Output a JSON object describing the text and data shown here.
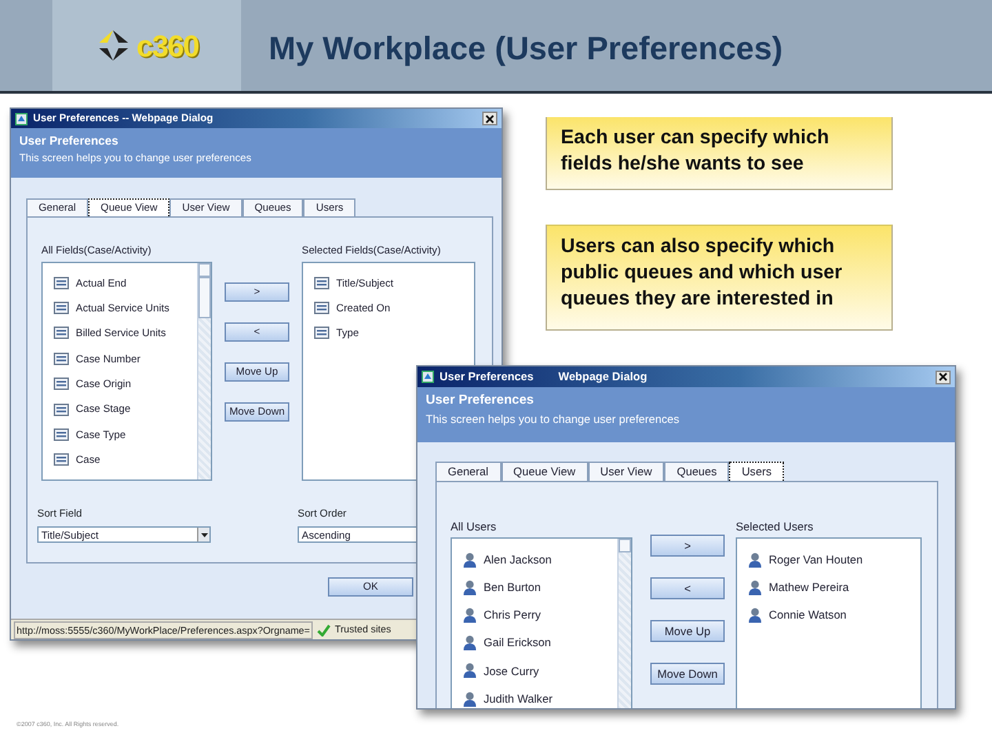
{
  "slide": {
    "title": "My Workplace (User Preferences)",
    "logo_text": "c360",
    "footer": "©2007 c360, Inc. All Rights reserved."
  },
  "callouts": [
    {
      "text": "Each user can specify which fields he/she wants to see"
    },
    {
      "text": "Users can also specify which public queues and which user queues they are interested in"
    }
  ],
  "dialogs": [
    {
      "title": [
        "User Preferences -- Webpage Dialog"
      ],
      "heading": "User Preferences",
      "subheading": "This screen helps you to change user preferences",
      "tabs": [
        {
          "label": "General",
          "selected": false
        },
        {
          "label": "Queue View",
          "selected": true
        },
        {
          "label": "User View",
          "selected": false
        },
        {
          "label": "Queues",
          "selected": false
        },
        {
          "label": "Users",
          "selected": false
        }
      ],
      "kind": "field",
      "left_label": "All Fields(Case/Activity)",
      "left_items": [
        "Actual End",
        "Actual Service Units",
        "Billed Service Units",
        "Case Number",
        "Case Origin",
        "Case Stage",
        "Case Type",
        "Case"
      ],
      "right_label": "Selected Fields(Case/Activity)",
      "right_items": [
        "Title/Subject",
        "Created On",
        "Type"
      ],
      "buttons": [
        ">",
        "<",
        "Move Up",
        "Move Down"
      ],
      "sort_field_label": "Sort Field",
      "sort_field_value": "Title/Subject",
      "sort_order_label": "Sort Order",
      "sort_order_value": "Ascending",
      "ok_button": "OK",
      "status_url": "http://moss:5555/c360/MyWorkPlace/Preferences.aspx?Orgname=",
      "status_zone": "Trusted sites"
    },
    {
      "title": [
        "User Preferences",
        "Webpage Dialog"
      ],
      "heading": "User Preferences",
      "subheading": "This screen helps you to change user preferences",
      "tabs": [
        {
          "label": "General",
          "selected": false
        },
        {
          "label": "Queue View",
          "selected": false
        },
        {
          "label": "User View",
          "selected": false
        },
        {
          "label": "Queues",
          "selected": false
        },
        {
          "label": "Users",
          "selected": true
        }
      ],
      "kind": "user",
      "left_label": "All Users",
      "left_items": [
        "Alen Jackson",
        "Ben Burton",
        "Chris Perry",
        "Gail Erickson",
        "Jose Curry",
        "Judith Walker"
      ],
      "right_label": "Selected Users",
      "right_items": [
        "Roger Van Houten",
        "Mathew Pereira",
        "Connie Watson"
      ],
      "buttons": [
        ">",
        "<",
        "Move Up",
        "Move Down"
      ]
    }
  ]
}
